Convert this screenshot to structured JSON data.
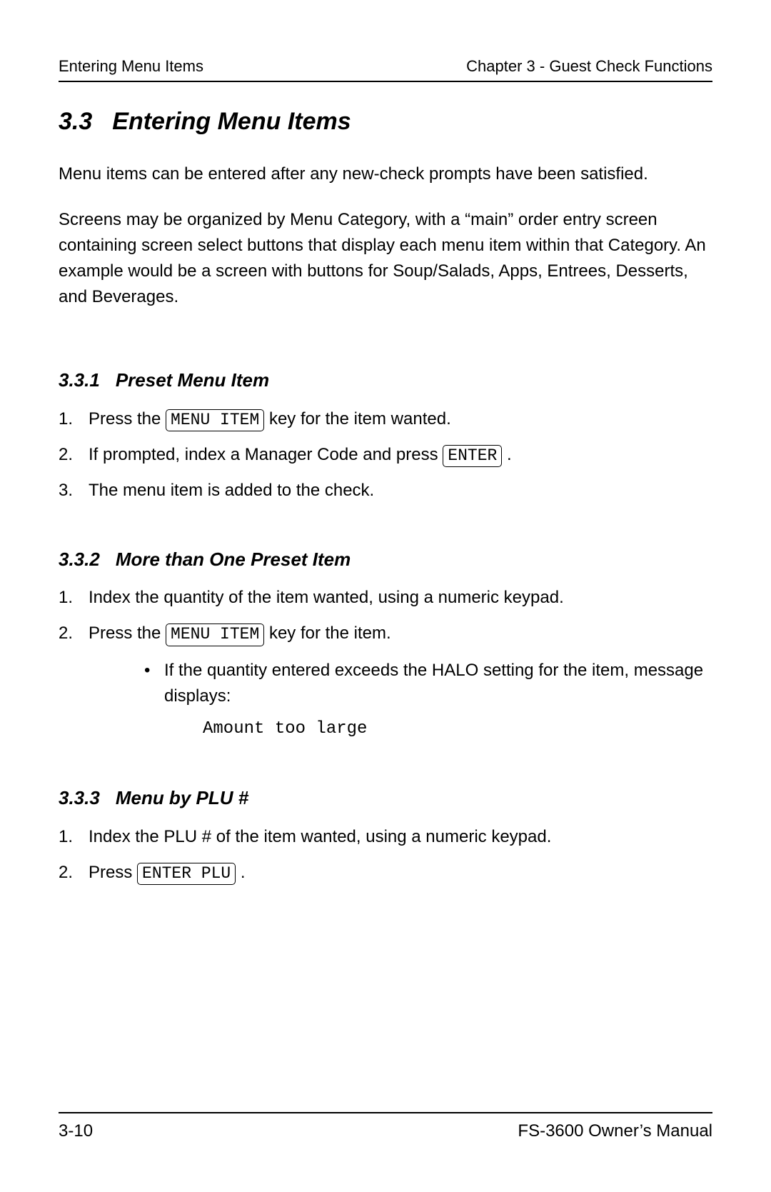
{
  "header": {
    "left": "Entering Menu Items",
    "right": "Chapter 3 - Guest Check Functions"
  },
  "title": {
    "number": "3.3",
    "text": "Entering Menu Items"
  },
  "intro1": "Menu items can be entered after any new-check prompts have been satisfied.",
  "intro2": "Screens may be organized by Menu Category, with a “main” order entry screen containing screen select buttons that display each menu item within that Category.  An example would be a screen with buttons for Soup/Salads, Apps, Entrees, Desserts, and Beverages.",
  "s331": {
    "number": "3.3.1",
    "title": "Preset Menu Item",
    "step1_a": "Press the ",
    "step1_key": "MENU ITEM",
    "step1_b": " key for the item wanted.",
    "step2_a": "If prompted, index a Manager Code and press ",
    "step2_key": "ENTER",
    "step2_b": " .",
    "step3": "The menu item is added to the check."
  },
  "s332": {
    "number": "3.3.2",
    "title": "More than One Preset Item",
    "step1": "Index the quantity of the item wanted, using a numeric keypad.",
    "step2_a": "Press the ",
    "step2_key": "MENU ITEM",
    "step2_b": " key for the item.",
    "bullet": "If the quantity entered exceeds the HALO setting for the item, message displays:",
    "msg": "Amount too large"
  },
  "s333": {
    "number": "3.3.3",
    "title": "Menu by PLU #",
    "step1": "Index the PLU # of the item wanted, using a numeric keypad.",
    "step2_a": "Press ",
    "step2_key": "ENTER PLU",
    "step2_b": " ."
  },
  "footer": {
    "left": "3-10",
    "right": "FS-3600 Owner’s Manual"
  }
}
